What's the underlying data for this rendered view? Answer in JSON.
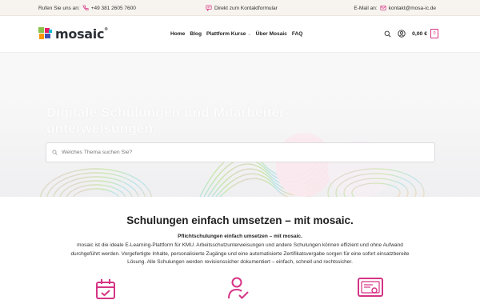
{
  "topbar": {
    "phone_label": "Rufen Sie uns an:",
    "phone_number": "+49 381 2605 7600",
    "contact_form": "Direkt zum Kontaktformular",
    "email_label": "E-Mail an:",
    "email": "kontakt@mosa-ic.de"
  },
  "header": {
    "logo_text": "mosaic",
    "logo_mark": "®",
    "nav": [
      {
        "label": "Home"
      },
      {
        "label": "Blog"
      },
      {
        "label": "Plattform Kurse"
      },
      {
        "label": "Über Mosaic"
      },
      {
        "label": "FAQ"
      }
    ],
    "cart_total": "0,00 €",
    "cart_count": "0"
  },
  "hero": {
    "title": "Digitale Schulungen und Mitarbeiter-unterweisungen",
    "search_placeholder": "Welches Thema suchen Sie?"
  },
  "content": {
    "heading": "Schulungen einfach umsetzen – mit mosaic.",
    "lead": "Pflichtschulungen einfach umsetzen – mit mosaic.",
    "body": "mosaic ist die ideale E-Learning-Plattform für KMU. Arbeitsschutzunterweisungen und andere Schulungen können effizient und ohne Aufwand durchgeführt werden. Vorgefertigte Inhalte, personalisierte Zugänge und eine automatisierte Zertifikatsvergabe sorgen für eine sofort einsatzbereite Lösung. Alle Schulungen werden revisionssicher dokumentiert – einfach, schnell und rechtssicher."
  },
  "colors": {
    "accent": "#d63384",
    "topbar_bg": "#f7f3ee",
    "text": "#222222"
  },
  "icons": [
    "phone-icon",
    "chat-icon",
    "mail-icon",
    "search-icon",
    "user-icon",
    "calendar-icon",
    "person-check-icon",
    "certificate-icon"
  ]
}
